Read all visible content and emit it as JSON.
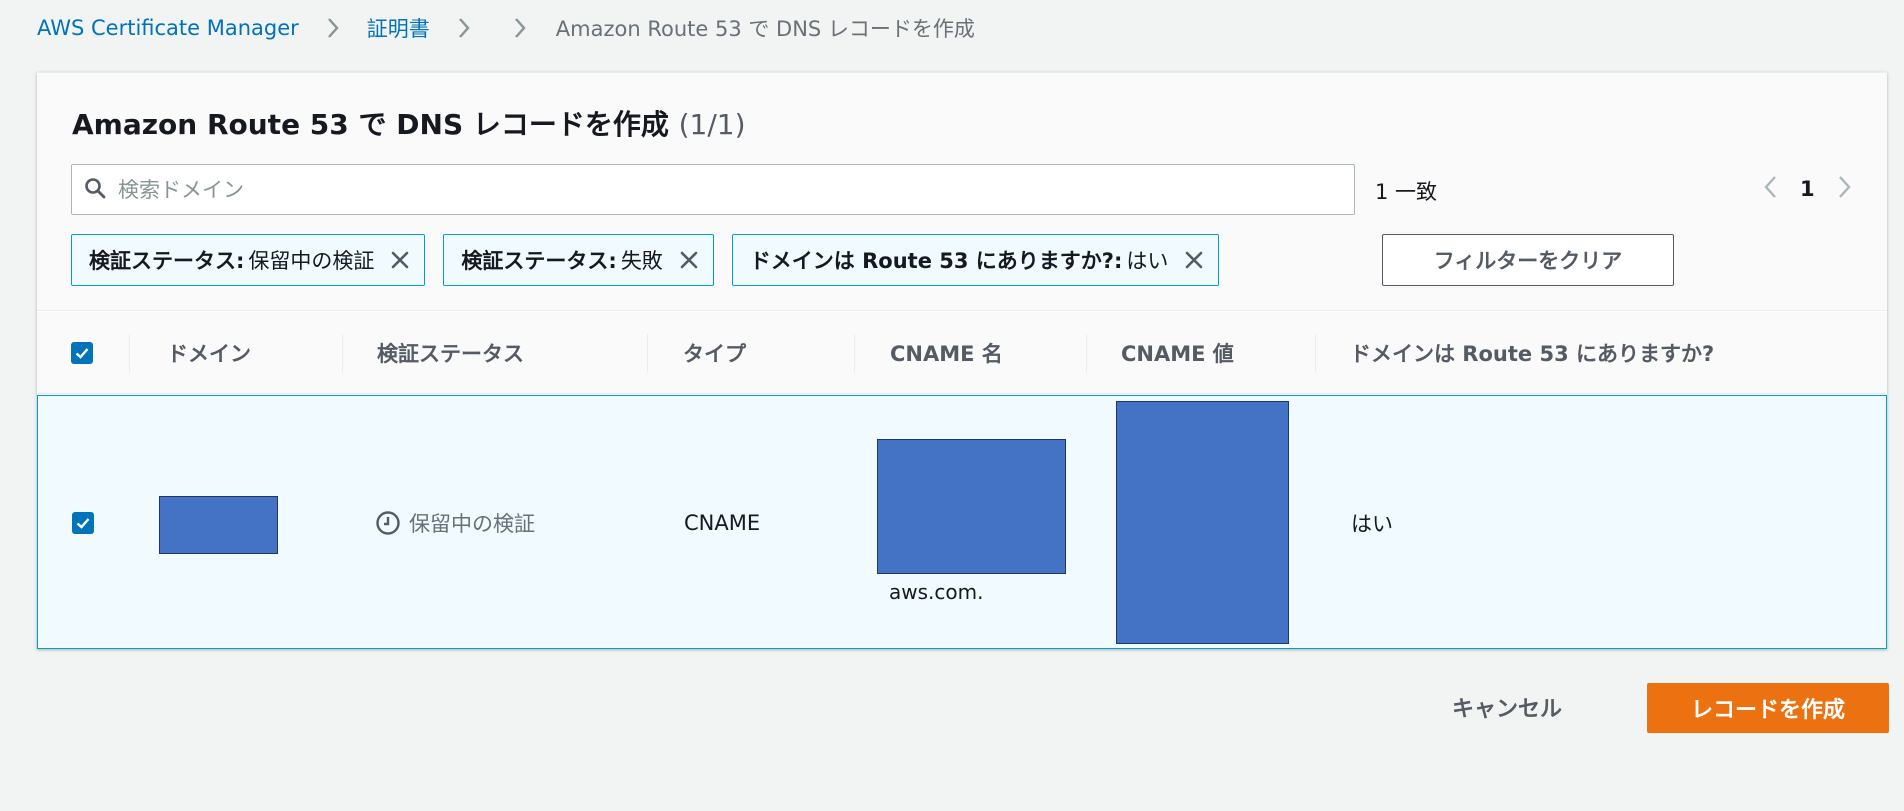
{
  "breadcrumb": {
    "items": [
      "AWS Certificate Manager",
      "証明書",
      "Amazon Route 53 で DNS レコードを作成"
    ]
  },
  "panel": {
    "title": "Amazon Route 53 で DNS レコードを作成",
    "count": "(1/1)"
  },
  "search": {
    "placeholder": "検索ドメイン",
    "value": "",
    "match_count": "1 一致"
  },
  "pagination": {
    "current_page": "1"
  },
  "filters": [
    {
      "key": "検証ステータス:",
      "value": "保留中の検証"
    },
    {
      "key": "検証ステータス:",
      "value": "失敗"
    },
    {
      "key": "ドメインは Route 53 にありますか?:",
      "value": "はい"
    }
  ],
  "clear_filters_label": "フィルターをクリア",
  "table": {
    "columns": [
      "ドメイン",
      "検証ステータス",
      "タイプ",
      "CNAME 名",
      "CNAME 値",
      "ドメインは Route 53 にありますか?"
    ],
    "rows": [
      {
        "selected": true,
        "domain": "",
        "status": "保留中の検証",
        "type": "CNAME",
        "cname_name_suffix": "aws.com.",
        "cname_value": "",
        "in_route53": "はい"
      }
    ]
  },
  "footer": {
    "cancel_label": "キャンセル",
    "create_label": "レコードを作成"
  },
  "colors": {
    "link": "#0073bb",
    "primary": "#ec7211",
    "token_border": "#00a1c9",
    "selected_row_bg": "#f1faff",
    "redaction": "#4472c4"
  }
}
